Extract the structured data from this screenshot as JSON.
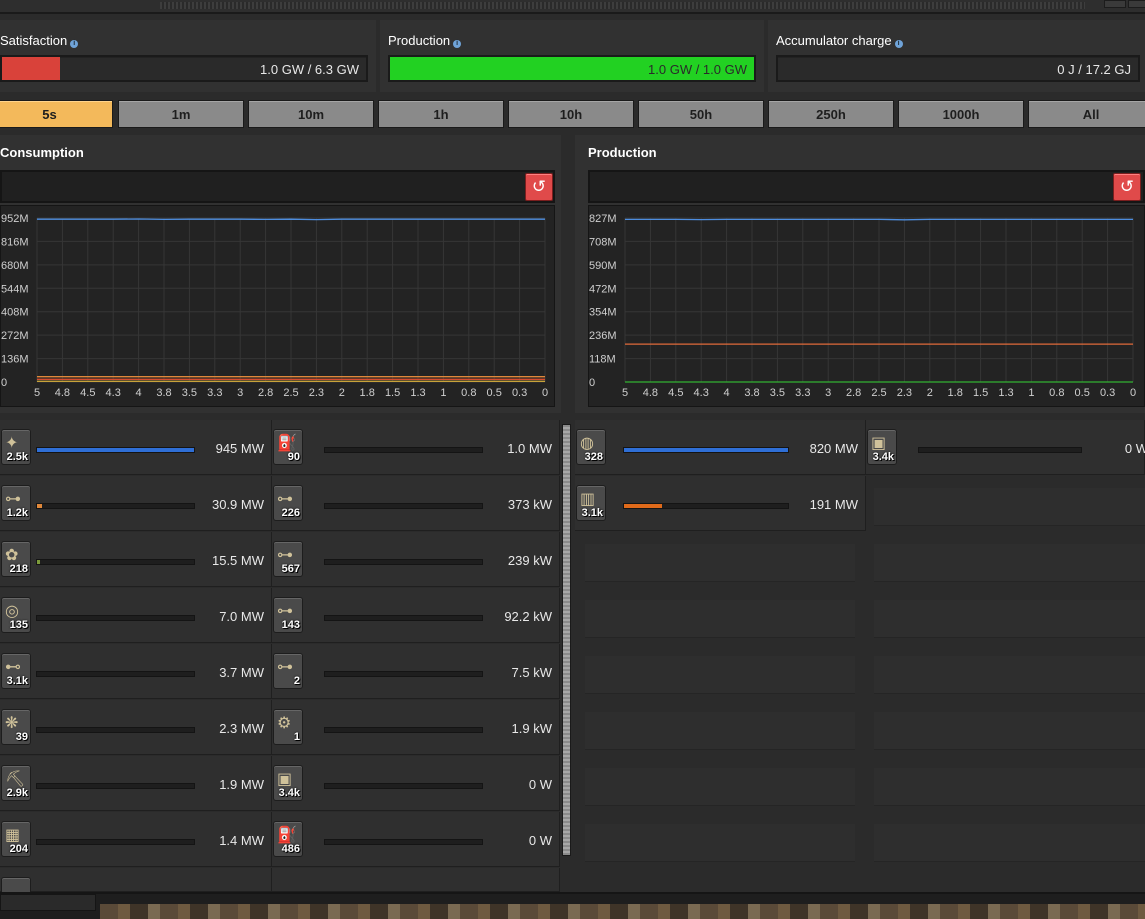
{
  "summary": {
    "satisfaction": {
      "label": "Satisfaction",
      "value": "1.0 GW / 6.3 GW",
      "fraction": 0.16,
      "color": "#d9423a"
    },
    "production": {
      "label": "Production",
      "value": "1.0 GW / 1.0 GW",
      "fraction": 1.0,
      "color": "#22d122"
    },
    "accumulator": {
      "label": "Accumulator charge",
      "value": "0 J / 17.2 GJ",
      "fraction": 0.0,
      "color": "#777777"
    }
  },
  "time_tabs": [
    "5s",
    "1m",
    "10m",
    "1h",
    "10h",
    "50h",
    "250h",
    "1000h",
    "All"
  ],
  "active_tab": "5s",
  "consumption_title": "Consumption",
  "production_title": "Production",
  "reset_icon": "↺",
  "chart_data": [
    {
      "type": "line",
      "x_ticks": [
        "5",
        "4.8",
        "4.5",
        "4.3",
        "4",
        "3.8",
        "3.5",
        "3.3",
        "3",
        "2.8",
        "2.5",
        "2.3",
        "2",
        "1.8",
        "1.5",
        "1.3",
        "1",
        "0.8",
        "0.5",
        "0.3",
        "0"
      ],
      "y_ticks": [
        "952M",
        "816M",
        "680M",
        "544M",
        "408M",
        "272M",
        "136M",
        "0"
      ],
      "ylim": [
        0,
        952
      ],
      "series": [
        {
          "color": "#4d8ddf",
          "values": [
            945,
            945,
            945,
            945,
            946,
            944,
            945,
            945,
            945,
            944,
            945,
            943,
            945,
            945,
            945,
            945,
            945,
            945,
            945,
            945,
            945
          ]
        },
        {
          "color": "#e0883a",
          "values": [
            30.9,
            30.9,
            30.9,
            30.9,
            30.9,
            30.9,
            30.9,
            30.9,
            30.9,
            30.9,
            30.9,
            30.9,
            30.9,
            30.9,
            30.9,
            30.9,
            30.9,
            30.9,
            30.9,
            30.9,
            30.9
          ]
        },
        {
          "color": "#d44c2e",
          "values": [
            15.5,
            15.5,
            15.5,
            15.5,
            15.5,
            15.5,
            15.5,
            15.5,
            15.5,
            15.5,
            15.5,
            15.5,
            15.5,
            15.5,
            15.5,
            15.5,
            15.5,
            15.5,
            15.5,
            15.5,
            15.5
          ]
        },
        {
          "color": "#c9a23a",
          "values": [
            4,
            4,
            4,
            4,
            4,
            4,
            4,
            4,
            4,
            4,
            4,
            4,
            4,
            4,
            4,
            4,
            4,
            4,
            4,
            4,
            4
          ]
        }
      ]
    },
    {
      "type": "line",
      "x_ticks": [
        "5",
        "4.8",
        "4.5",
        "4.3",
        "4",
        "3.8",
        "3.5",
        "3.3",
        "3",
        "2.8",
        "2.5",
        "2.3",
        "2",
        "1.8",
        "1.5",
        "1.3",
        "1",
        "0.8",
        "0.5",
        "0.3",
        "0"
      ],
      "y_ticks": [
        "827M",
        "708M",
        "590M",
        "472M",
        "354M",
        "236M",
        "118M",
        "0"
      ],
      "ylim": [
        0,
        827
      ],
      "series": [
        {
          "color": "#4d8ddf",
          "values": [
            820,
            820,
            820,
            819,
            820,
            820,
            820,
            820,
            820,
            820,
            820,
            818,
            820,
            820,
            820,
            820,
            820,
            820,
            820,
            820,
            820
          ]
        },
        {
          "color": "#e06a3a",
          "values": [
            191,
            191,
            191,
            191,
            191,
            191,
            191,
            191,
            191,
            191,
            191,
            191,
            191,
            191,
            191,
            191,
            191,
            191,
            191,
            191,
            191
          ]
        },
        {
          "color": "#33b233",
          "values": [
            0,
            0,
            0,
            0,
            0,
            0,
            0,
            0,
            0,
            0,
            0,
            0,
            0,
            0,
            0,
            0,
            0,
            0,
            0,
            0,
            0
          ]
        }
      ]
    }
  ],
  "consumers_col1": [
    {
      "count": "2.5k",
      "power": "945 MW",
      "fraction": 1.0,
      "color": "#2f6fd6",
      "icon": "radar-icon",
      "glyph": "✦"
    },
    {
      "count": "1.2k",
      "power": "30.9 MW",
      "fraction": 0.033,
      "color": "#e0883a",
      "icon": "inserter-icon",
      "glyph": "⊶"
    },
    {
      "count": "218",
      "power": "15.5 MW",
      "fraction": 0.016,
      "color": "#7c9a3a",
      "icon": "assembler-icon",
      "glyph": "✿"
    },
    {
      "count": "135",
      "power": "7.0 MW",
      "fraction": 0.0,
      "color": "#7c9a3a",
      "icon": "lab-icon",
      "glyph": "◎"
    },
    {
      "count": "3.1k",
      "power": "3.7 MW",
      "fraction": 0.0,
      "color": "#7c9a3a",
      "icon": "fast-inserter-icon",
      "glyph": "⊷"
    },
    {
      "count": "39",
      "power": "2.3 MW",
      "fraction": 0.0,
      "color": "#7c9a3a",
      "icon": "roboport-icon",
      "glyph": "❋"
    },
    {
      "count": "2.9k",
      "power": "1.9 MW",
      "fraction": 0.0,
      "color": "#7c9a3a",
      "icon": "electric-drill-icon",
      "glyph": "⛏"
    },
    {
      "count": "204",
      "power": "1.4 MW",
      "fraction": 0.0,
      "color": "#7c9a3a",
      "icon": "furnace-icon",
      "glyph": "▦"
    }
  ],
  "consumers_col2": [
    {
      "count": "90",
      "power": "1.0 MW",
      "fraction": 0.0,
      "color": "#7c9a3a",
      "icon": "pump-icon",
      "glyph": "⛽"
    },
    {
      "count": "226",
      "power": "373 kW",
      "fraction": 0.0,
      "color": "#7c9a3a",
      "icon": "long-inserter-icon",
      "glyph": "⊶"
    },
    {
      "count": "567",
      "power": "239 kW",
      "fraction": 0.0,
      "color": "#7c9a3a",
      "icon": "filter-inserter-icon",
      "glyph": "⊶"
    },
    {
      "count": "143",
      "power": "92.2 kW",
      "fraction": 0.0,
      "color": "#7c9a3a",
      "icon": "stack-inserter-icon",
      "glyph": "⊶"
    },
    {
      "count": "2",
      "power": "7.5 kW",
      "fraction": 0.0,
      "color": "#7c9a3a",
      "icon": "stack-filter-inserter-icon",
      "glyph": "⊶"
    },
    {
      "count": "1",
      "power": "1.9 kW",
      "fraction": 0.0,
      "color": "#7c9a3a",
      "icon": "centrifuge-icon",
      "glyph": "⚙"
    },
    {
      "count": "3.4k",
      "power": "0 W",
      "fraction": 0.0,
      "color": "#7c9a3a",
      "icon": "solar-panel-icon",
      "glyph": "▣"
    },
    {
      "count": "486",
      "power": "0 W",
      "fraction": 0.0,
      "color": "#7c9a3a",
      "icon": "pumpjack-icon",
      "glyph": "⛽"
    }
  ],
  "producers_col1": [
    {
      "count": "328",
      "power": "820 MW",
      "fraction": 1.0,
      "color": "#2f6fd6",
      "icon": "steam-turbine-icon",
      "glyph": "◍"
    },
    {
      "count": "3.1k",
      "power": "191 MW",
      "fraction": 0.23,
      "color": "#e06a1a",
      "icon": "solar-panel-icon",
      "glyph": "▥"
    }
  ],
  "producers_col2": [
    {
      "count": "3.4k",
      "power": "0 W",
      "fraction": 0.0,
      "color": "#7c9a3a",
      "icon": "accumulator-icon",
      "glyph": "▣"
    }
  ]
}
